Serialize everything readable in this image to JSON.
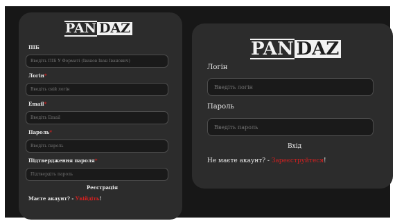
{
  "register": {
    "logo": {
      "part1": "PAN",
      "part2": "DAZ"
    },
    "fields": [
      {
        "label": "ПІБ",
        "required": "",
        "placeholder": "Введіть ПІБ У Форматі (Іванов Іван Іванович)"
      },
      {
        "label": "Логін",
        "required": "*",
        "placeholder": "Введіть свій логін"
      },
      {
        "label": "Email",
        "required": "*",
        "placeholder": "Введіть Email"
      },
      {
        "label": "Пароль",
        "required": "*",
        "placeholder": "Введіть пароль"
      },
      {
        "label": "Підтвердження пароля",
        "required": "*",
        "placeholder": "Підтвердіть пароль"
      }
    ],
    "submit": "Реєстрація",
    "footer_text": "Маєте акаунт? - ",
    "footer_link": "Увійдіть",
    "footer_end": "!"
  },
  "login": {
    "logo": {
      "part1": "PAN",
      "part2": "DAZ"
    },
    "login_label": "Логін",
    "login_placeholder": "Введіть логін",
    "password_label": "Пароль",
    "password_placeholder": "Введіть пароль",
    "submit": "Вхід",
    "footer_text": "Не маєте акаунт? - ",
    "footer_link": "Зареєструйтеся",
    "footer_end": "!"
  },
  "colors": {
    "background": "#171717",
    "card": "#2c2c2c",
    "accent_red": "#d42020"
  }
}
